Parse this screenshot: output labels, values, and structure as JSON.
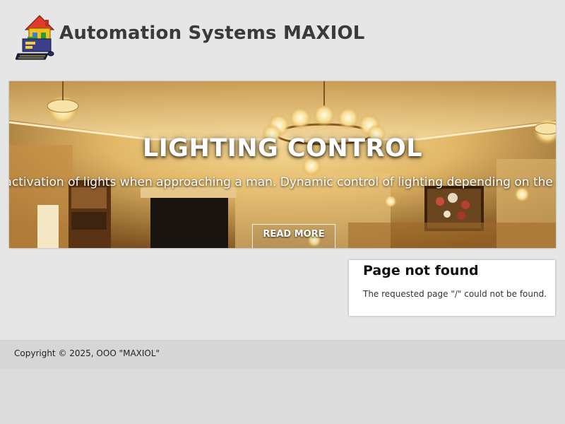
{
  "header": {
    "site_name": "Automation Systems MAXIOL",
    "logo_icon": "smart-house-computer-icon"
  },
  "hero": {
    "title": "LIGHTING CONTROL",
    "description": "Automatic activation of lights when approaching a man. Dynamic control of lighting depending on the time of day.",
    "button_label": "READ MORE"
  },
  "notice": {
    "title": "Page not found",
    "message": "The requested page \"/\" could not be found."
  },
  "footer": {
    "copyright": "Copyright © 2025, OOO \"MAXIOL\""
  },
  "colors": {
    "background": "#e6e6e6",
    "footer_background": "#d6d6d6",
    "title_text": "#3a3a3a",
    "hero_text": "#ffffff"
  }
}
